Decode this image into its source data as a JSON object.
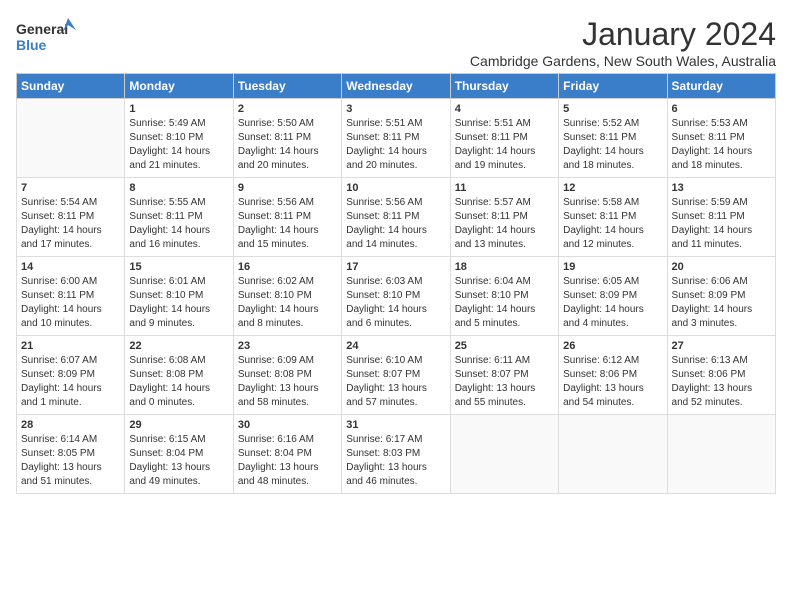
{
  "logo": {
    "general": "General",
    "blue": "Blue"
  },
  "title": "January 2024",
  "subtitle": "Cambridge Gardens, New South Wales, Australia",
  "days_of_week": [
    "Sunday",
    "Monday",
    "Tuesday",
    "Wednesday",
    "Thursday",
    "Friday",
    "Saturday"
  ],
  "weeks": [
    [
      {
        "day": "",
        "sunrise": "",
        "sunset": "",
        "daylight": "",
        "empty": true
      },
      {
        "day": "1",
        "sunrise": "Sunrise: 5:49 AM",
        "sunset": "Sunset: 8:10 PM",
        "daylight": "Daylight: 14 hours and 21 minutes."
      },
      {
        "day": "2",
        "sunrise": "Sunrise: 5:50 AM",
        "sunset": "Sunset: 8:11 PM",
        "daylight": "Daylight: 14 hours and 20 minutes."
      },
      {
        "day": "3",
        "sunrise": "Sunrise: 5:51 AM",
        "sunset": "Sunset: 8:11 PM",
        "daylight": "Daylight: 14 hours and 20 minutes."
      },
      {
        "day": "4",
        "sunrise": "Sunrise: 5:51 AM",
        "sunset": "Sunset: 8:11 PM",
        "daylight": "Daylight: 14 hours and 19 minutes."
      },
      {
        "day": "5",
        "sunrise": "Sunrise: 5:52 AM",
        "sunset": "Sunset: 8:11 PM",
        "daylight": "Daylight: 14 hours and 18 minutes."
      },
      {
        "day": "6",
        "sunrise": "Sunrise: 5:53 AM",
        "sunset": "Sunset: 8:11 PM",
        "daylight": "Daylight: 14 hours and 18 minutes."
      }
    ],
    [
      {
        "day": "7",
        "sunrise": "Sunrise: 5:54 AM",
        "sunset": "Sunset: 8:11 PM",
        "daylight": "Daylight: 14 hours and 17 minutes."
      },
      {
        "day": "8",
        "sunrise": "Sunrise: 5:55 AM",
        "sunset": "Sunset: 8:11 PM",
        "daylight": "Daylight: 14 hours and 16 minutes."
      },
      {
        "day": "9",
        "sunrise": "Sunrise: 5:56 AM",
        "sunset": "Sunset: 8:11 PM",
        "daylight": "Daylight: 14 hours and 15 minutes."
      },
      {
        "day": "10",
        "sunrise": "Sunrise: 5:56 AM",
        "sunset": "Sunset: 8:11 PM",
        "daylight": "Daylight: 14 hours and 14 minutes."
      },
      {
        "day": "11",
        "sunrise": "Sunrise: 5:57 AM",
        "sunset": "Sunset: 8:11 PM",
        "daylight": "Daylight: 14 hours and 13 minutes."
      },
      {
        "day": "12",
        "sunrise": "Sunrise: 5:58 AM",
        "sunset": "Sunset: 8:11 PM",
        "daylight": "Daylight: 14 hours and 12 minutes."
      },
      {
        "day": "13",
        "sunrise": "Sunrise: 5:59 AM",
        "sunset": "Sunset: 8:11 PM",
        "daylight": "Daylight: 14 hours and 11 minutes."
      }
    ],
    [
      {
        "day": "14",
        "sunrise": "Sunrise: 6:00 AM",
        "sunset": "Sunset: 8:11 PM",
        "daylight": "Daylight: 14 hours and 10 minutes."
      },
      {
        "day": "15",
        "sunrise": "Sunrise: 6:01 AM",
        "sunset": "Sunset: 8:10 PM",
        "daylight": "Daylight: 14 hours and 9 minutes."
      },
      {
        "day": "16",
        "sunrise": "Sunrise: 6:02 AM",
        "sunset": "Sunset: 8:10 PM",
        "daylight": "Daylight: 14 hours and 8 minutes."
      },
      {
        "day": "17",
        "sunrise": "Sunrise: 6:03 AM",
        "sunset": "Sunset: 8:10 PM",
        "daylight": "Daylight: 14 hours and 6 minutes."
      },
      {
        "day": "18",
        "sunrise": "Sunrise: 6:04 AM",
        "sunset": "Sunset: 8:10 PM",
        "daylight": "Daylight: 14 hours and 5 minutes."
      },
      {
        "day": "19",
        "sunrise": "Sunrise: 6:05 AM",
        "sunset": "Sunset: 8:09 PM",
        "daylight": "Daylight: 14 hours and 4 minutes."
      },
      {
        "day": "20",
        "sunrise": "Sunrise: 6:06 AM",
        "sunset": "Sunset: 8:09 PM",
        "daylight": "Daylight: 14 hours and 3 minutes."
      }
    ],
    [
      {
        "day": "21",
        "sunrise": "Sunrise: 6:07 AM",
        "sunset": "Sunset: 8:09 PM",
        "daylight": "Daylight: 14 hours and 1 minute."
      },
      {
        "day": "22",
        "sunrise": "Sunrise: 6:08 AM",
        "sunset": "Sunset: 8:08 PM",
        "daylight": "Daylight: 14 hours and 0 minutes."
      },
      {
        "day": "23",
        "sunrise": "Sunrise: 6:09 AM",
        "sunset": "Sunset: 8:08 PM",
        "daylight": "Daylight: 13 hours and 58 minutes."
      },
      {
        "day": "24",
        "sunrise": "Sunrise: 6:10 AM",
        "sunset": "Sunset: 8:07 PM",
        "daylight": "Daylight: 13 hours and 57 minutes."
      },
      {
        "day": "25",
        "sunrise": "Sunrise: 6:11 AM",
        "sunset": "Sunset: 8:07 PM",
        "daylight": "Daylight: 13 hours and 55 minutes."
      },
      {
        "day": "26",
        "sunrise": "Sunrise: 6:12 AM",
        "sunset": "Sunset: 8:06 PM",
        "daylight": "Daylight: 13 hours and 54 minutes."
      },
      {
        "day": "27",
        "sunrise": "Sunrise: 6:13 AM",
        "sunset": "Sunset: 8:06 PM",
        "daylight": "Daylight: 13 hours and 52 minutes."
      }
    ],
    [
      {
        "day": "28",
        "sunrise": "Sunrise: 6:14 AM",
        "sunset": "Sunset: 8:05 PM",
        "daylight": "Daylight: 13 hours and 51 minutes."
      },
      {
        "day": "29",
        "sunrise": "Sunrise: 6:15 AM",
        "sunset": "Sunset: 8:04 PM",
        "daylight": "Daylight: 13 hours and 49 minutes."
      },
      {
        "day": "30",
        "sunrise": "Sunrise: 6:16 AM",
        "sunset": "Sunset: 8:04 PM",
        "daylight": "Daylight: 13 hours and 48 minutes."
      },
      {
        "day": "31",
        "sunrise": "Sunrise: 6:17 AM",
        "sunset": "Sunset: 8:03 PM",
        "daylight": "Daylight: 13 hours and 46 minutes."
      },
      {
        "day": "",
        "sunrise": "",
        "sunset": "",
        "daylight": "",
        "empty": true
      },
      {
        "day": "",
        "sunrise": "",
        "sunset": "",
        "daylight": "",
        "empty": true
      },
      {
        "day": "",
        "sunrise": "",
        "sunset": "",
        "daylight": "",
        "empty": true
      }
    ]
  ]
}
